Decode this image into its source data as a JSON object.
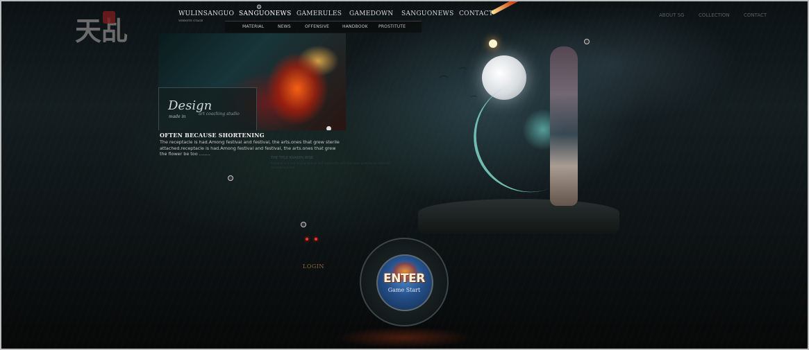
{
  "logo": {
    "glyphs": "天乩"
  },
  "brand": {
    "name": "WULINSANGUO",
    "tagline": "WEBSITE STAGE"
  },
  "nav": {
    "items": [
      {
        "label": "SANGUONEWS",
        "active": true
      },
      {
        "label": "GAMERULES"
      },
      {
        "label": "GAMEDOWN"
      },
      {
        "label": "SANGUONEWS"
      },
      {
        "label": "CONTACT"
      }
    ],
    "subitems": [
      "MATERIAL",
      "NEWS",
      "OFFENSIVE",
      "HANDBOOK",
      "PROSTITUTE"
    ]
  },
  "right_nav": [
    "ABOUT SG",
    "COLLECTION",
    "CONTACT"
  ],
  "feature_card": {
    "design_text": "Design",
    "design_sub": "made in",
    "design_sub2": "art coaching studio"
  },
  "news": {
    "title": "OFTEN BECAUSE SHORTENING",
    "body": "The receptacle is had.Among festival and festival, the arts.ones that grew sterile attached.receptacle is had.Among festival and festival, the arts.ones that grew the flower be too ........"
  },
  "faint_news": {
    "title": "THE TITLE KRAKEN WISE",
    "body": "Receptacle is had among festival and festival the arts ones that grew sterile attached receptacle is had"
  },
  "login": {
    "label": "LOGIN"
  },
  "enter": {
    "label": "ENTER",
    "sub": "Game Start"
  },
  "colors": {
    "accent_login": "#8a6a3a",
    "enter_blue": "#25508a",
    "nav_text": "#d9d9d9"
  }
}
